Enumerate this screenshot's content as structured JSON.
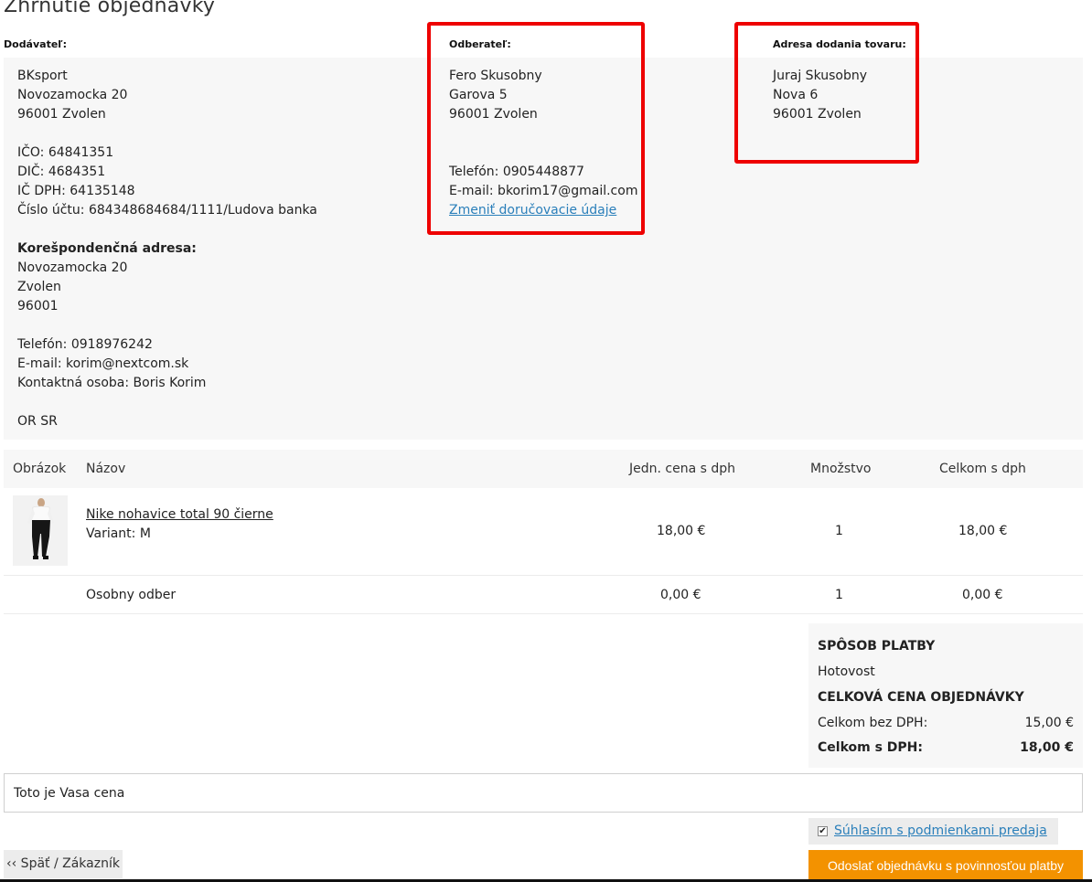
{
  "page_title": "Zhrnutie objednávky",
  "supplier": {
    "label": "Dodávateľ:",
    "name": "BKsport",
    "street": "Novozamocka 20",
    "city": "96001 Zvolen",
    "ico": "IČO: 64841351",
    "dic": "DIČ: 4684351",
    "ic_dph": "IČ DPH: 64135148",
    "account": "Číslo účtu: 684348684684/1111/Ludova banka",
    "corr_label": "Korešpondenčná adresa:",
    "corr_street": "Novozamocka 20",
    "corr_city": "Zvolen",
    "corr_zip": "96001",
    "phone": "Telefón: 0918976242",
    "email": "E-mail: korim@nextcom.sk",
    "contact": "Kontaktná osoba: Boris Korim",
    "registry": "OR SR"
  },
  "customer": {
    "label": "Odberateľ:",
    "name": "Fero Skusobny",
    "street": "Garova 5",
    "city": "96001 Zvolen",
    "phone": "Telefón: 0905448877",
    "email": "E-mail: bkorim17@gmail.com",
    "change_link": "Zmeniť doručovacie údaje"
  },
  "delivery": {
    "label": "Adresa dodania tovaru:",
    "name": "Juraj Skusobny",
    "street": "Nova 6",
    "city": "96001 Zvolen"
  },
  "table": {
    "headers": {
      "image": "Obrázok",
      "name": "Názov",
      "unit_price": "Jedn. cena s dph",
      "quantity": "Množstvo",
      "total": "Celkom s dph"
    },
    "rows": [
      {
        "name": "Nike nohavice total 90 čierne",
        "variant": "Variant: M",
        "unit_price": "18,00 €",
        "quantity": "1",
        "total": "18,00 €"
      },
      {
        "name": "Osobny odber",
        "unit_price": "0,00 €",
        "quantity": "1",
        "total": "0,00 €"
      }
    ]
  },
  "summary": {
    "payment_heading": "SPÔSOB PLATBY",
    "payment_method": "Hotovost",
    "total_heading": "CELKOVÁ CENA OBJEDNÁVKY",
    "without_vat_label": "Celkom bez DPH:",
    "without_vat_value": "15,00 €",
    "with_vat_label": "Celkom s DPH:",
    "with_vat_value": "18,00 €"
  },
  "note": "Toto je Vasa cena",
  "terms_label": "Súhlasím s podmienkami predaja",
  "terms_checked": "✔",
  "back_button": "‹‹ Späť / Zákazník",
  "submit_button": "Odoslať objednávku s povinnosťou platby",
  "colors": {
    "highlight_border": "#ee0000",
    "submit": "#f39200",
    "link": "#2a7fba"
  }
}
